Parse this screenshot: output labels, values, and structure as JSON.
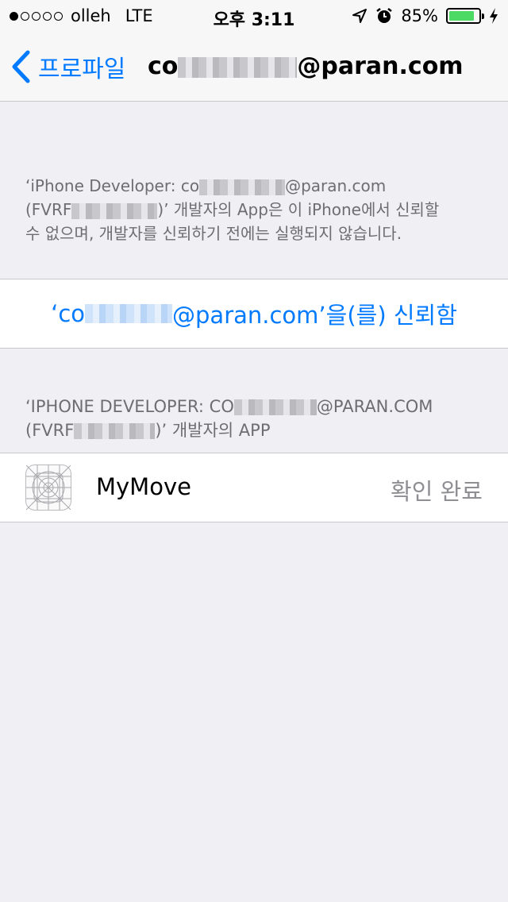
{
  "status_bar": {
    "carrier": "olleh",
    "network": "LTE",
    "time": "오후 3:11",
    "battery": "85%",
    "battery_level": 0.85
  },
  "nav": {
    "back_label": "프로파일",
    "title_prefix": "co",
    "title_suffix": "@paran.com"
  },
  "description": {
    "line1_prefix": "‘iPhone Developer: co",
    "line1_suffix": "@paran.com",
    "line2_prefix": "(FVRF",
    "line2_suffix": ")’ 개발자의 App은 이 iPhone에서 신뢰할",
    "line3": "수 없으며, 개발자를 신뢰하기 전에는 실행되지 않습니다."
  },
  "trust_button": {
    "prefix": "‘co",
    "suffix": "@paran.com’을(를) 신뢰함"
  },
  "apps_header": {
    "line1_prefix": "‘IPHONE DEVELOPER: CO",
    "line1_suffix": "@PARAN.COM",
    "line2_prefix": "(FVRF",
    "line2_suffix": ")’ 개발자의 APP"
  },
  "apps": [
    {
      "name": "MyMove",
      "status": "확인 완료",
      "icon": "app-placeholder-icon"
    }
  ],
  "colors": {
    "accent": "#007aff",
    "battery": "#4cd964",
    "background": "#efeff4"
  }
}
